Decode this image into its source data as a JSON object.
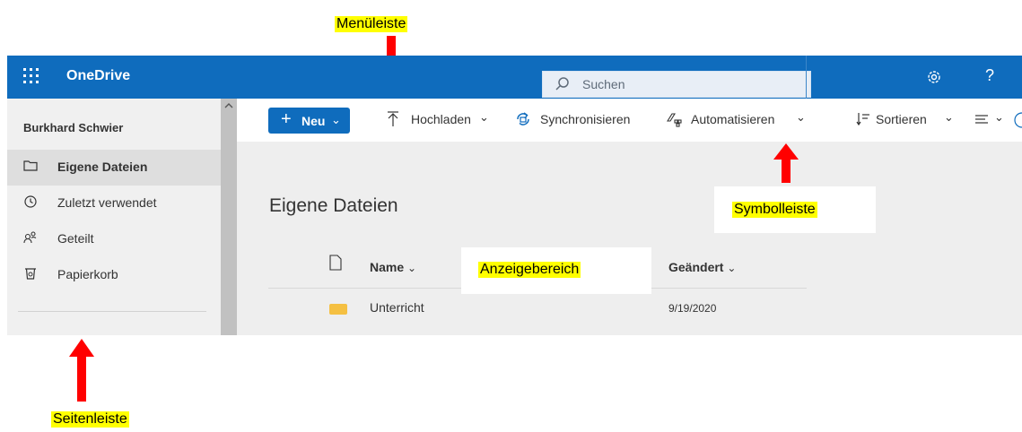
{
  "annotations": {
    "menu": "Menüleiste",
    "sidebar": "Seitenleiste",
    "toolbar": "Symbolleiste",
    "display": "Anzeigebereich"
  },
  "topbar": {
    "brand": "OneDrive",
    "search_placeholder": "Suchen",
    "help_label": "?",
    "color": "#0f6cbd"
  },
  "sidebar": {
    "user": "Burkhard Schwier",
    "items": [
      {
        "label": "Eigene Dateien",
        "icon": "folder-icon",
        "active": true
      },
      {
        "label": "Zuletzt verwendet",
        "icon": "recent-icon"
      },
      {
        "label": "Geteilt",
        "icon": "shared-icon"
      },
      {
        "label": "Papierkorb",
        "icon": "recycle-bin-icon"
      }
    ]
  },
  "toolbar": {
    "new_label": "Neu",
    "upload_label": "Hochladen",
    "sync_label": "Synchronisieren",
    "automate_label": "Automatisieren",
    "sort_label": "Sortieren"
  },
  "main": {
    "title": "Eigene Dateien",
    "columns": {
      "name": "Name",
      "modified": "Geändert"
    },
    "rows": [
      {
        "name": "Unterricht",
        "modified": "9/19/2020"
      }
    ]
  }
}
